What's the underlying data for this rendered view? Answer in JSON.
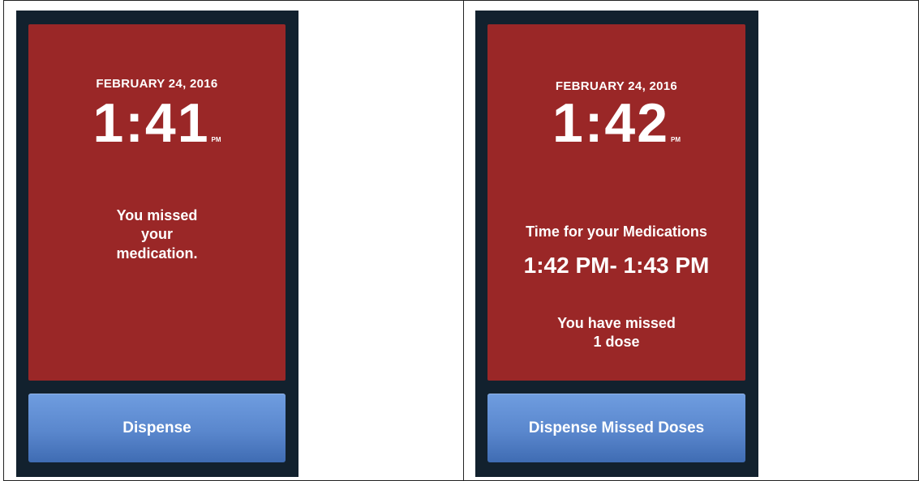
{
  "left_screen": {
    "date": "FEBRUARY 24, 2016",
    "time": "1:41",
    "ampm": "PM",
    "message_lines": [
      "You missed",
      "your",
      "medication."
    ],
    "button_label": "Dispense"
  },
  "right_screen": {
    "date": "FEBRUARY 24, 2016",
    "time": "1:42",
    "ampm": "PM",
    "heading": "Time for your Medications",
    "time_range": "1:42 PM- 1:43 PM",
    "missed_lines": [
      "You have missed",
      "1 dose"
    ],
    "button_label": "Dispense Missed Doses"
  },
  "colors": {
    "alert_red": "#9a2727",
    "device_frame": "#12212e",
    "button_blue": "#5a87cd"
  }
}
